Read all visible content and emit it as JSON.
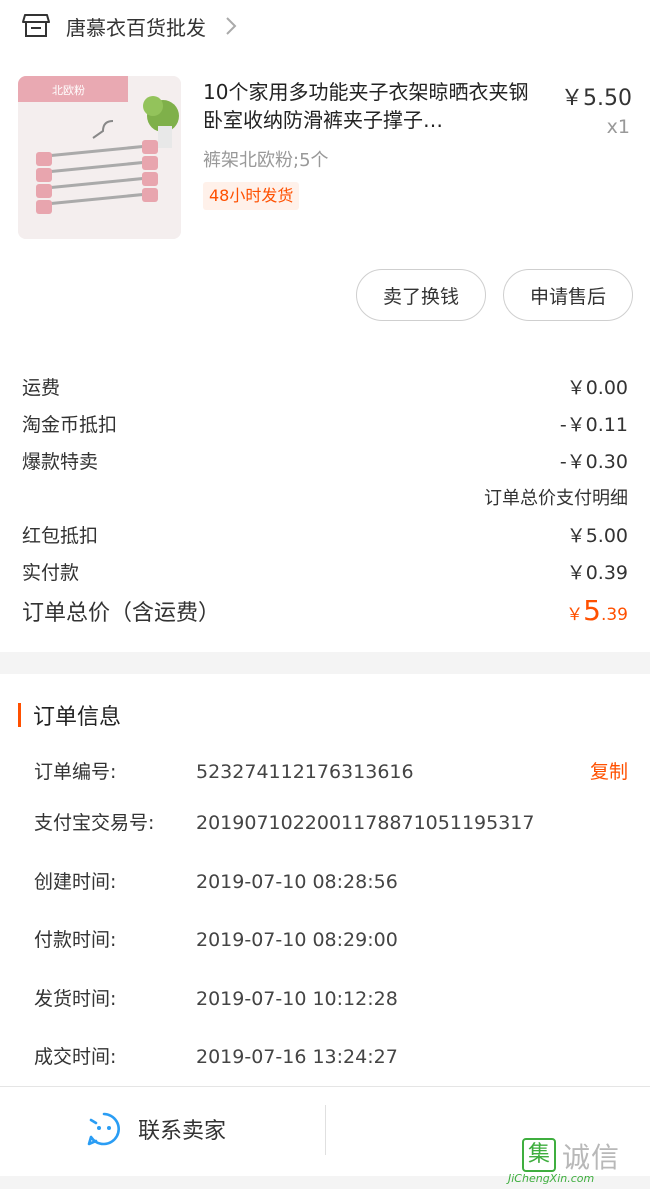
{
  "shop": {
    "name": "唐慕衣百货批发",
    "icon": "store-icon"
  },
  "product": {
    "thumb_label": "北欧粉",
    "title": "10个家用多功能夹子衣架晾晒衣夹钢卧室收纳防滑裤夹子撑子…",
    "price": "￥5.50",
    "qty": "x1",
    "sku": "裤架北欧粉;5个",
    "badge": "48小时发货"
  },
  "actions": {
    "resell": "卖了换钱",
    "aftersale": "申请售后"
  },
  "fees": [
    {
      "label": "运费",
      "value": "￥0.00"
    },
    {
      "label": "淘金币抵扣",
      "value": "-￥0.11"
    },
    {
      "label": "爆款特卖",
      "value": "-￥0.30"
    }
  ],
  "fee_detail_link": "订单总价支付明细",
  "payments": [
    {
      "label": "红包抵扣",
      "value": "￥5.00"
    },
    {
      "label": "实付款",
      "value": "￥0.39"
    }
  ],
  "total": {
    "label": "订单总价（含运费）",
    "currency": "￥",
    "int": "5",
    "dec": ".39"
  },
  "order_info": {
    "title": "订单信息",
    "copy": "复制",
    "rows": [
      {
        "label": "订单编号:",
        "value": "523274112176313616"
      },
      {
        "label": "支付宝交易号:",
        "value": "2019071022001178871051195317"
      },
      {
        "label": "创建时间:",
        "value": "2019-07-10 08:28:56"
      },
      {
        "label": "付款时间:",
        "value": "2019-07-10 08:29:00"
      },
      {
        "label": "发货时间:",
        "value": "2019-07-10 10:12:28"
      },
      {
        "label": "成交时间:",
        "value": "2019-07-16 13:24:27"
      }
    ]
  },
  "bottom": {
    "contact_label": "联系卖家"
  },
  "watermark": {
    "logo": "集",
    "text": "诚信",
    "url": "JiChengXin.com"
  },
  "colors": {
    "accent": "#ff5000",
    "badge_bg": "#fff1ea",
    "watermark_green": "#3fae3f"
  }
}
